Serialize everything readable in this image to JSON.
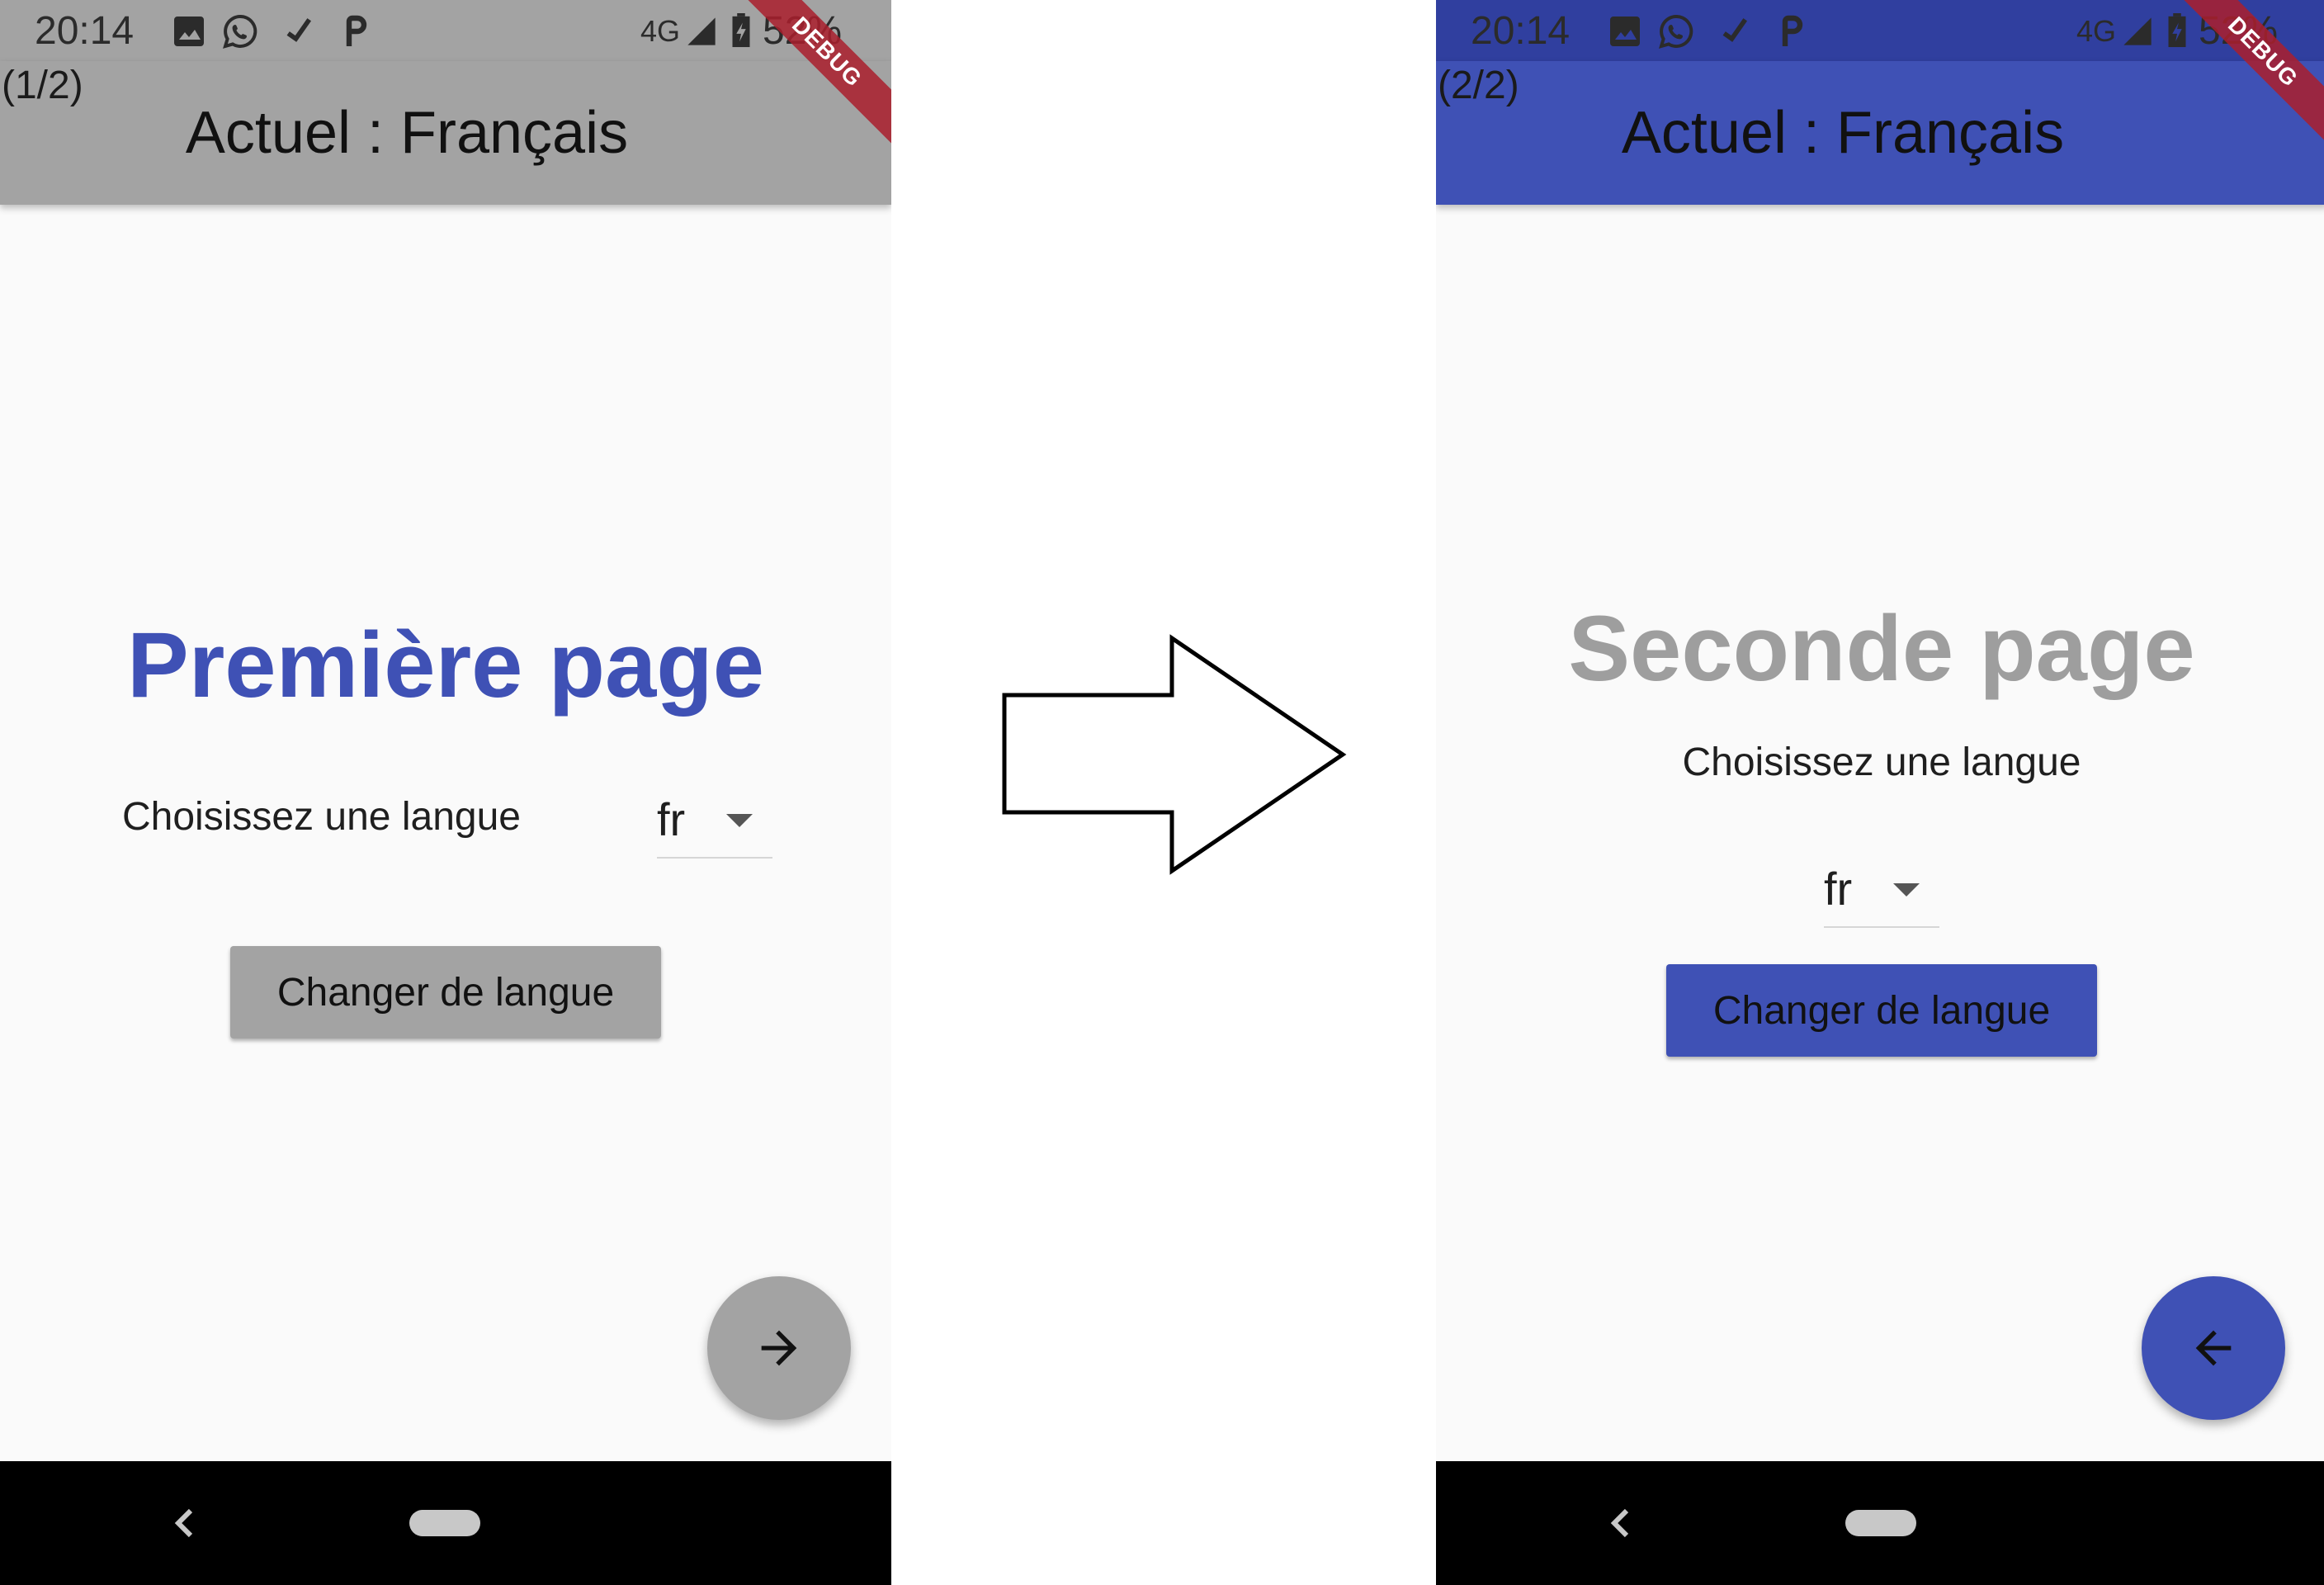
{
  "status_bar": {
    "time": "20:14",
    "network": "4G",
    "battery": "52%",
    "icons": [
      "image-icon",
      "whatsapp-icon",
      "check-icon",
      "parking-icon",
      "signal-icon",
      "battery-icon"
    ]
  },
  "debug_banner": "DEBUG",
  "colors": {
    "indigo": "#3f51b5",
    "grey": "#9e9e9e",
    "appbar_grey": "#a3a3a3"
  },
  "left_screen": {
    "page_counter": "(1/2)",
    "title": "Actuel : Français",
    "heading": "Première page",
    "choose_label": "Choisissez une langue",
    "language_value": "fr",
    "change_button": "Changer de langue",
    "fab_icon": "arrow-forward-icon"
  },
  "right_screen": {
    "page_counter": "(2/2)",
    "title": "Actuel : Français",
    "heading": "Seconde page",
    "choose_label": "Choisissez une langue",
    "language_value": "fr",
    "change_button": "Changer de langue",
    "fab_icon": "arrow-back-icon"
  },
  "transition_arrow_icon": "right-arrow-icon"
}
